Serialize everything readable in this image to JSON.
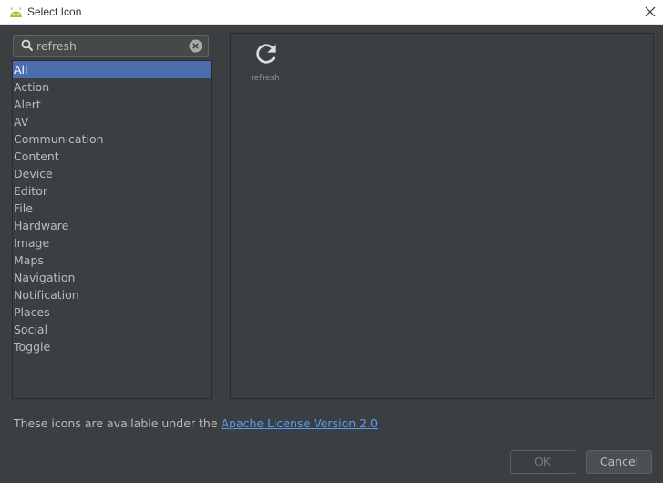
{
  "window": {
    "title": "Select Icon",
    "app_icon": "android-icon",
    "close_icon": "close-icon"
  },
  "search": {
    "value": "refresh",
    "search_icon": "search-icon",
    "clear_icon": "clear-icon"
  },
  "categories": [
    "All",
    "Action",
    "Alert",
    "AV",
    "Communication",
    "Content",
    "Device",
    "Editor",
    "File",
    "Hardware",
    "Image",
    "Maps",
    "Navigation",
    "Notification",
    "Places",
    "Social",
    "Toggle"
  ],
  "selected_category": "All",
  "results": [
    {
      "name": "refresh",
      "icon": "refresh-icon"
    }
  ],
  "license": {
    "prefix": "These icons are available under the ",
    "link": "Apache License Version 2.0"
  },
  "buttons": {
    "ok": "OK",
    "cancel": "Cancel"
  },
  "colors": {
    "background": "#3c3f41",
    "selection": "#4b6eaf",
    "link": "#589df6",
    "android_green": "#a4c639"
  }
}
